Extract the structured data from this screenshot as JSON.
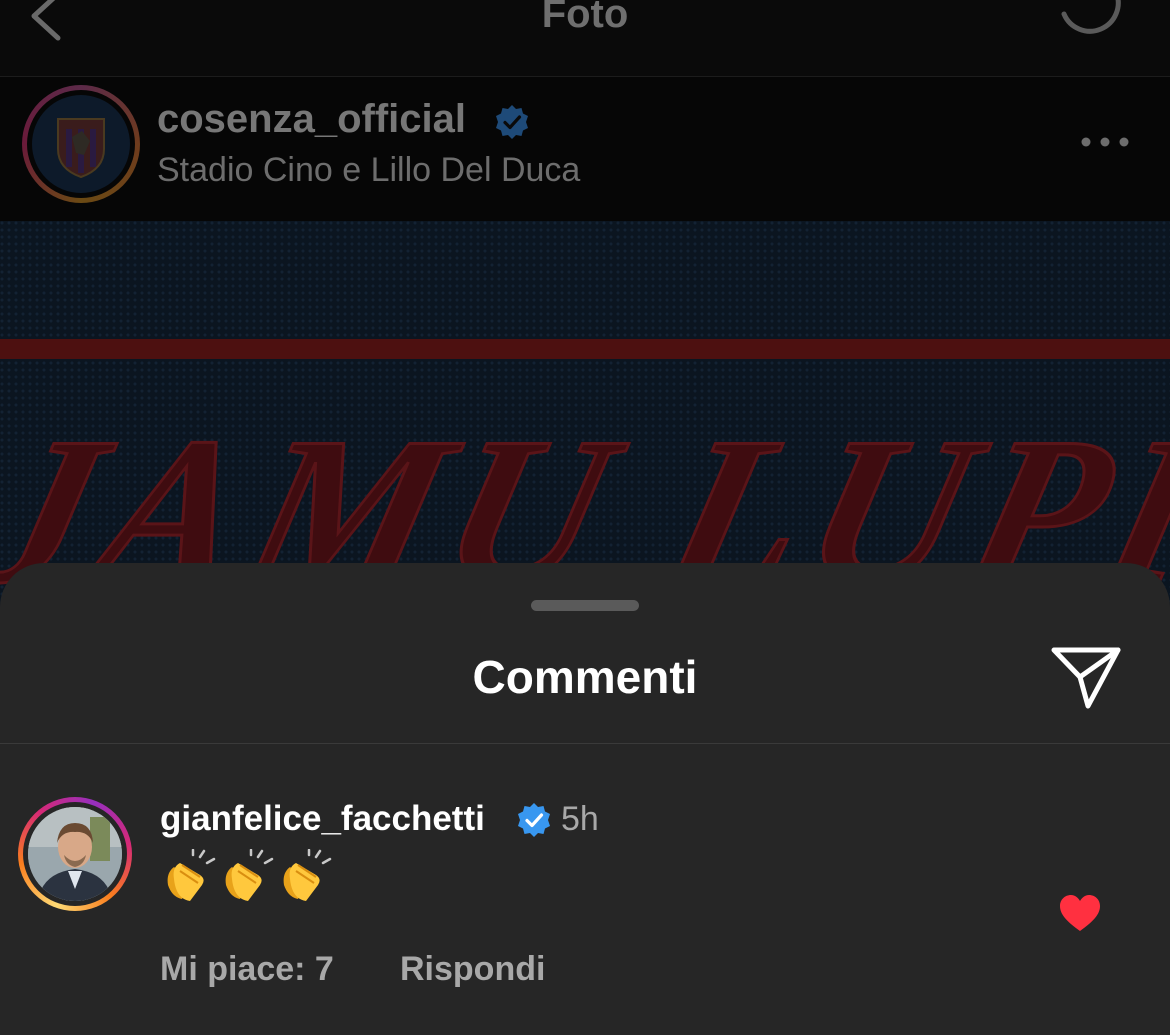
{
  "topbar": {
    "title": "Foto",
    "back_icon": "chevron-left-icon",
    "status_icon": "loading-spinner-icon"
  },
  "post": {
    "username": "cosenza_official",
    "verified": true,
    "location": "Stadio Cino e Lillo Del Duca",
    "more_icon": "more-horizontal-icon",
    "image_text": "JAMU LUPI"
  },
  "comments_sheet": {
    "title": "Commenti",
    "share_icon": "send-icon",
    "comment": {
      "username": "gianfelice_facchetti",
      "verified": true,
      "time": "5h",
      "text": "👏👏👏",
      "likes_label": "Mi piace: 7",
      "reply_label": "Rispondi",
      "liked": true,
      "like_icon": "heart-icon"
    }
  },
  "colors": {
    "sheet_background": "#262626",
    "verified_blue": "#3897f0",
    "heart_red": "#ff3040",
    "muted_text": "#a8a8a8"
  }
}
